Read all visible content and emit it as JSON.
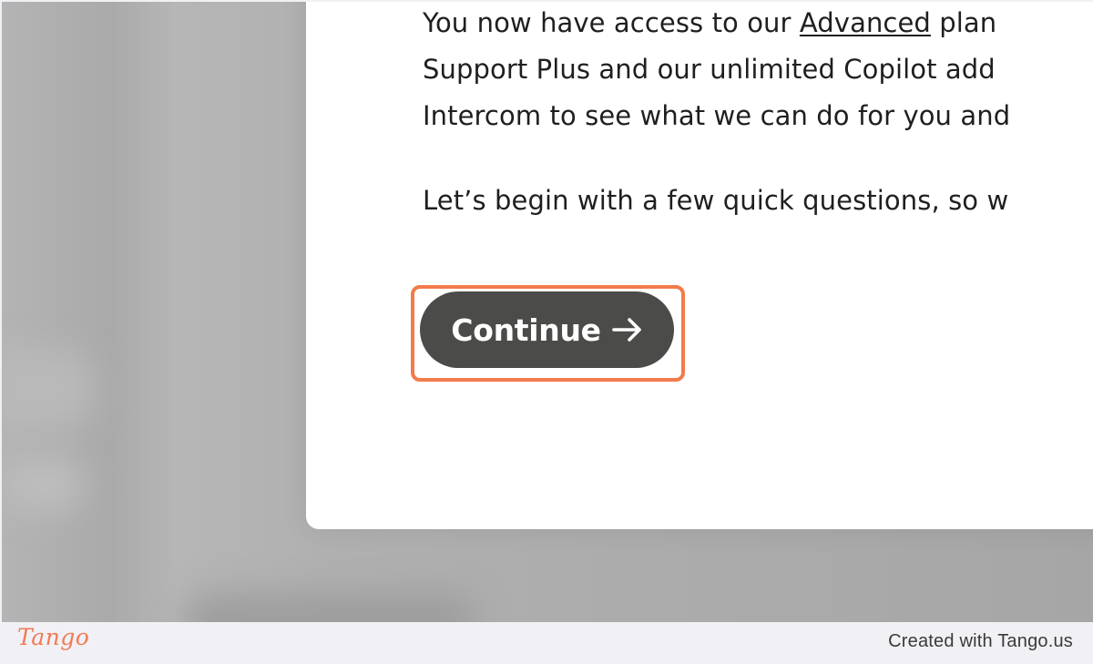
{
  "modal": {
    "line1_before": "You now have access to our ",
    "line1_link": "Advanced",
    "line1_after": " plan",
    "line2": "Support Plus and our unlimited Copilot add",
    "line3": "Intercom to see what we can do for you and",
    "line4": "Let’s begin with a few quick questions, so w"
  },
  "continue_button": {
    "label": "Continue",
    "icon": "arrow-right-icon"
  },
  "footer": {
    "logo": "Tango",
    "credit": "Created with Tango.us"
  },
  "colors": {
    "highlight": "#f37b4b",
    "button_bg": "#4b4b49",
    "logo": "#f07b56"
  }
}
